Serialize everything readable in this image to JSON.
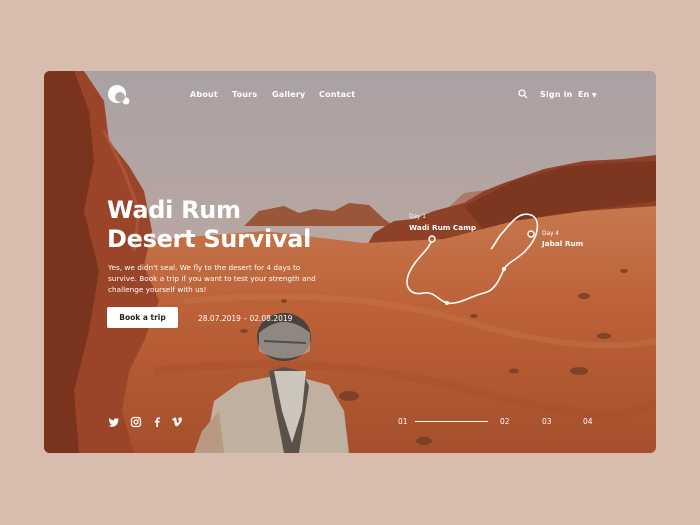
{
  "nav": {
    "items": [
      "About",
      "Tours",
      "Gallery",
      "Contact"
    ],
    "signin": "Sign in",
    "language": "En"
  },
  "hero": {
    "title_line1": "Wadi Rum",
    "title_line2": "Desert Survival",
    "description": "Yes, we didn't seal. We fly to the desert for 4 days to survive. Book a trip if you want to test your strength and challenge yourself with us!",
    "button": "Book a trip",
    "dates": "28.07.2019 – 02.08.2019"
  },
  "route": {
    "start_day": "Day 1",
    "start_name": "Wadi Rum Camp",
    "end_day": "Day 4",
    "end_name": "Jabal Rum"
  },
  "pagination": [
    "01",
    "02",
    "03",
    "04"
  ],
  "pagination_active": "01",
  "social_icons": [
    "twitter-icon",
    "instagram-icon",
    "facebook-icon",
    "vimeo-icon"
  ],
  "colors": {
    "page_bg": "#d8bcad",
    "sand": "#bc6238",
    "rock": "#8e3e22",
    "sky": "#b7aaa6",
    "text": "#ffffff"
  }
}
